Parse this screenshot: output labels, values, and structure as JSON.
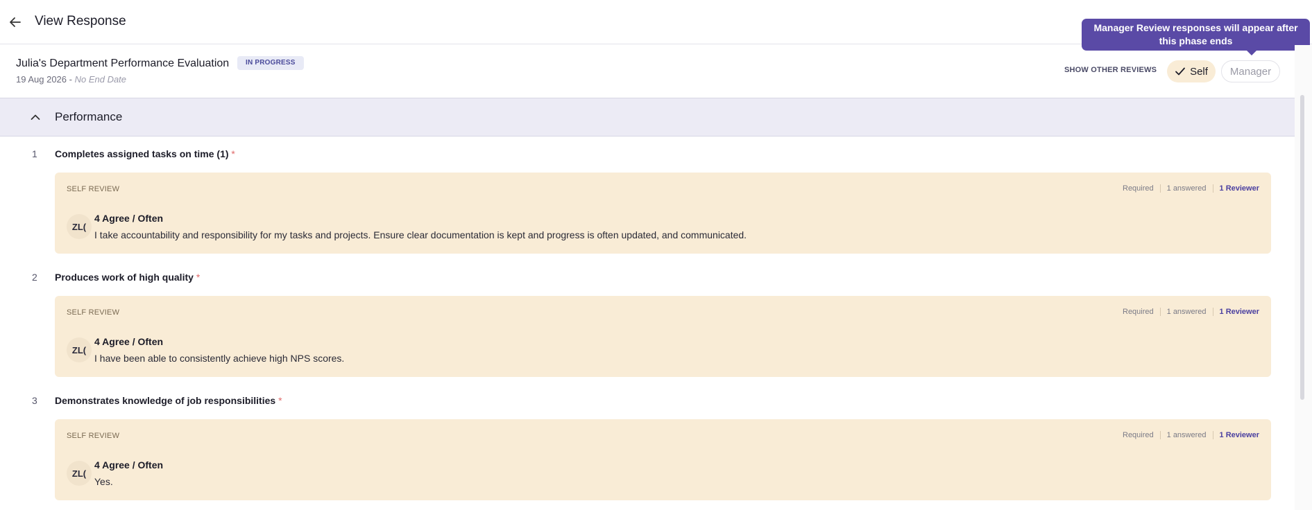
{
  "header": {
    "title": "View Response"
  },
  "tooltip": {
    "text": "Manager Review responses will appear after this phase ends"
  },
  "evaluation": {
    "title": "Julia's Department Performance Evaluation",
    "status": "IN PROGRESS",
    "start_date": "19 Aug 2026",
    "separator": " - ",
    "end_date": "No End Date"
  },
  "filters": {
    "label": "SHOW OTHER REVIEWS",
    "self_label": "Self",
    "manager_label": "Manager"
  },
  "section": {
    "title": "Performance"
  },
  "questions": [
    {
      "number": "1",
      "text": "Completes assigned tasks on time (1)",
      "required_mark": "*",
      "review": {
        "label": "SELF REVIEW",
        "required": "Required",
        "answered": "1 answered",
        "reviewers": "1 Reviewer",
        "avatar": "ZL(",
        "rating": "4 Agree / Often",
        "comment": "I take accountability and responsibility for my tasks and projects. Ensure clear documentation is kept and progress is often updated, and communicated."
      }
    },
    {
      "number": "2",
      "text": "Produces work of high quality",
      "required_mark": "*",
      "review": {
        "label": "SELF REVIEW",
        "required": "Required",
        "answered": "1 answered",
        "reviewers": "1 Reviewer",
        "avatar": "ZL(",
        "rating": "4 Agree / Often",
        "comment": "I have been able to consistently achieve high NPS scores."
      }
    },
    {
      "number": "3",
      "text": "Demonstrates knowledge of job responsibilities",
      "required_mark": "*",
      "review": {
        "label": "SELF REVIEW",
        "required": "Required",
        "answered": "1 answered",
        "reviewers": "1 Reviewer",
        "avatar": "ZL(",
        "rating": "4 Agree / Often",
        "comment": "Yes."
      }
    }
  ],
  "colors": {
    "accent": "#5a4aa6",
    "card_bg": "#f9ecd6",
    "section_bg": "#ecebf5"
  }
}
